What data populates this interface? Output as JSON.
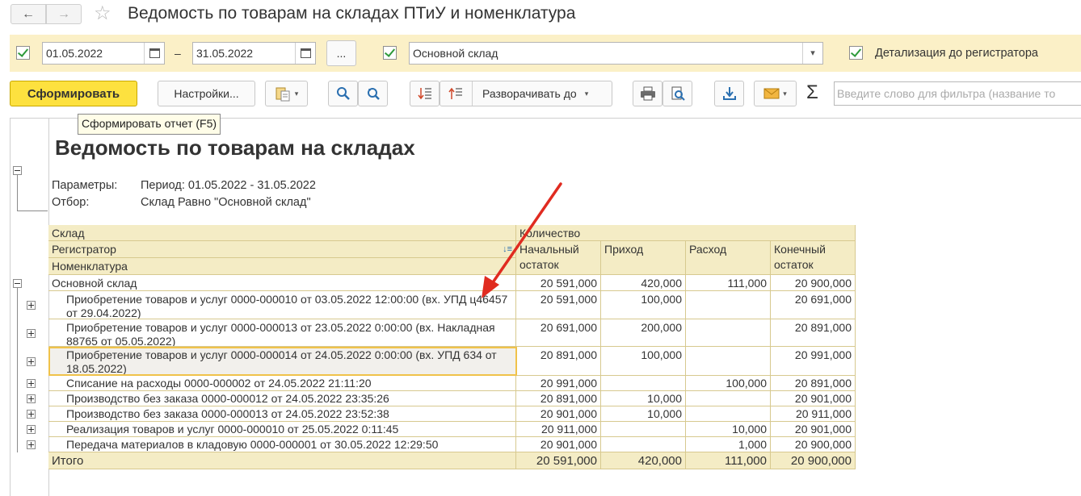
{
  "window": {
    "title": "Ведомость по товарам на складах  ПТиУ и номенклатура"
  },
  "params": {
    "period_enabled": true,
    "date_from": "01.05.2022",
    "dash": "–",
    "date_to": "31.05.2022",
    "more_label": "...",
    "warehouse_enabled": true,
    "warehouse": "Основной склад",
    "detail_enabled": true,
    "detail_label": "Детализация до регистратора"
  },
  "toolbar": {
    "generate_label": "Сформировать",
    "settings_label": "Настройки...",
    "expand_label": "Разворачивать до",
    "sigma": "Σ",
    "filter_placeholder": "Введите слово для фильтра (название то",
    "tooltip": "Сформировать отчет (F5)"
  },
  "report": {
    "title": "Ведомость по товарам на складах",
    "params_label": "Параметры:",
    "params_value": "Период: 01.05.2022 - 31.05.2022",
    "filter_label": "Отбор:",
    "filter_value": "Склад Равно \"Основной склад\"",
    "headers": {
      "warehouse": "Склад",
      "registrar": "Регистратор",
      "nomenclature": "Номенклатура",
      "quantity": "Количество",
      "start": "Начальный остаток",
      "income": "Приход",
      "expense": "Расход",
      "end": "Конечный остаток"
    },
    "group_row": {
      "name": "Основной склад",
      "start": "20 591,000",
      "income": "420,000",
      "expense": "111,000",
      "end": "20 900,000"
    },
    "rows": [
      {
        "name": "Приобретение товаров и услуг 0000-000010 от 03.05.2022 12:00:00 (вх. УПД ц46457 от 29.04.2022)",
        "start": "20 591,000",
        "income": "100,000",
        "expense": "",
        "end": "20 691,000"
      },
      {
        "name": "Приобретение товаров и услуг 0000-000013 от 23.05.2022 0:00:00 (вх. Накладная 88765 от 05.05.2022)",
        "start": "20 691,000",
        "income": "200,000",
        "expense": "",
        "end": "20 891,000"
      },
      {
        "name": "Приобретение товаров и услуг 0000-000014 от 24.05.2022 0:00:00 (вх. УПД 634 от 18.05.2022)",
        "start": "20 891,000",
        "income": "100,000",
        "expense": "",
        "end": "20 991,000"
      },
      {
        "name": "Списание на расходы 0000-000002 от 24.05.2022 21:11:20",
        "start": "20 991,000",
        "income": "",
        "expense": "100,000",
        "end": "20 891,000"
      },
      {
        "name": "Производство без заказа 0000-000012 от 24.05.2022 23:35:26",
        "start": "20 891,000",
        "income": "10,000",
        "expense": "",
        "end": "20 901,000"
      },
      {
        "name": "Производство без заказа 0000-000013 от 24.05.2022 23:52:38",
        "start": "20 901,000",
        "income": "10,000",
        "expense": "",
        "end": "20 911,000"
      },
      {
        "name": "Реализация товаров и услуг 0000-000010 от 25.05.2022 0:11:45",
        "start": "20 911,000",
        "income": "",
        "expense": "10,000",
        "end": "20 901,000"
      },
      {
        "name": "Передача материалов в кладовую 0000-000001 от 30.05.2022 12:29:50",
        "start": "20 901,000",
        "income": "",
        "expense": "1,000",
        "end": "20 900,000"
      }
    ],
    "total": {
      "label": "Итого",
      "start": "20 591,000",
      "income": "420,000",
      "expense": "111,000",
      "end": "20 900,000"
    }
  },
  "colors": {
    "accent_yellow": "#fde13f",
    "param_bg": "#fbf0c7",
    "table_header_bg": "#f4ecc5",
    "annotation_arrow": "#e02b20"
  }
}
